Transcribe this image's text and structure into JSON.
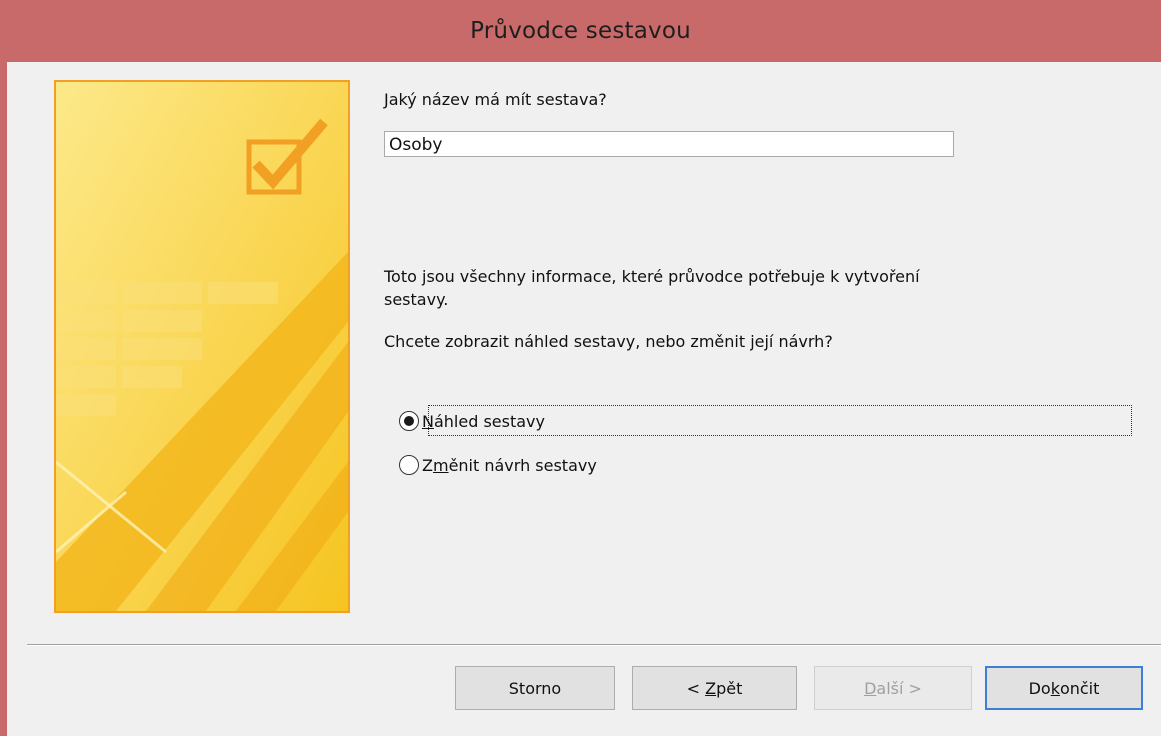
{
  "window": {
    "title": "Průvodce sestavou",
    "titlebar_color": "#c96a6a"
  },
  "name_section": {
    "question": "Jaký název má mít sestava?",
    "report_name_value": "Osoby"
  },
  "info": {
    "line1": "Toto jsou všechny informace, které průvodce potřebuje k vytvoření",
    "line2": "sestavy.",
    "question": "Chcete zobrazit náhled sestavy, nebo změnit její návrh?"
  },
  "options": [
    {
      "label_pre": "",
      "accel": "N",
      "label_post": "áhled sestavy",
      "selected": true
    },
    {
      "label_pre": "Z",
      "accel": "m",
      "label_post": "ěnit návrh sestavy",
      "selected": false
    }
  ],
  "buttons": {
    "cancel": {
      "pre": "Storno",
      "accel": "",
      "post": ""
    },
    "back": {
      "pre": "< ",
      "accel": "Z",
      "post": "pět"
    },
    "next": {
      "pre": "",
      "accel": "D",
      "post": "alší >"
    },
    "finish": {
      "pre": "Do",
      "accel": "k",
      "post": "ončit"
    }
  },
  "icons": {
    "side_image": "wizard-checkbox-illustration"
  },
  "colors": {
    "accent_border": "#f2a024",
    "side_yellow": "#f8d33a",
    "default_button_border": "#3c7fd6"
  }
}
